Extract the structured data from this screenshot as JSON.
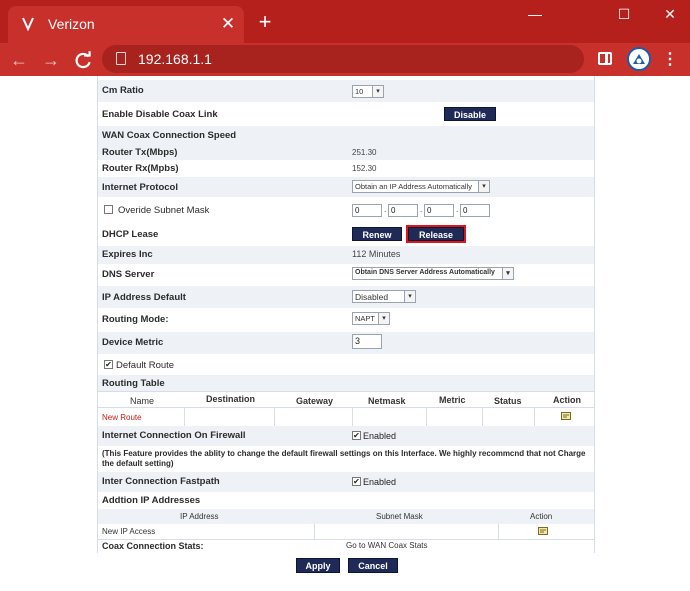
{
  "browser": {
    "tab_title": "Verizon",
    "new_tab": "+",
    "url": "192.168.1.1",
    "window_controls": {
      "minimize": "—",
      "maximize": "☐",
      "close": "✕"
    },
    "chrome_color": "#c8302b",
    "tabbar_color": "#b5201c"
  },
  "settings": {
    "cm_ratio": {
      "label": "Cm Ratio",
      "value": "10"
    },
    "coax_link": {
      "label": "Enable Disable Coax Link",
      "button": "Disable"
    },
    "wan_coax_speed": "WAN Coax Connection Speed",
    "router_tx": {
      "label": "Router Tx(Mbps)",
      "value": "251.30"
    },
    "router_rx": {
      "label": "Router Rx(Mpbs)",
      "value": "152.30"
    },
    "internet_protocol": {
      "label": "Internet Protocol",
      "value": "Obtain an IP Address Automatically"
    },
    "override_subnet": {
      "label": "Overide Subnet Mask",
      "octets": [
        "0",
        "0",
        "0",
        "0"
      ],
      "dot": "."
    },
    "dhcp_lease": {
      "label": "DHCP Lease",
      "renew": "Renew",
      "release": "Release"
    },
    "expires": {
      "label": "Expires Inc",
      "value": "112 Minutes"
    },
    "dns_server": {
      "label": "DNS Server",
      "value": "Obtain DNS Server Address Automatically"
    },
    "ip_default": {
      "label": "IP Address Default",
      "value": "Disabled"
    },
    "routing_mode": {
      "label": "Routing Mode:",
      "value": "NAPT"
    },
    "device_metric": {
      "label": "Device Metric",
      "value": "3"
    },
    "default_route": {
      "label": "Default Route",
      "check": "✔"
    },
    "routing_table": {
      "label": "Routing Table",
      "columns": [
        "Name",
        "Destination",
        "Gateway",
        "Netmask",
        "Metric",
        "Status",
        "Action"
      ],
      "new_route": "New Route"
    },
    "firewall": {
      "label": "Internet Connection On Firewall",
      "value": "Enabled"
    },
    "firewall_note": "(This Feature provides the ablity to change the default firewall settings on this Interface. We highly recommcnd that not Charge the default setting)",
    "fastpath": {
      "label": "Inter Connection Fastpath",
      "value": "Enabled"
    },
    "addition_ip": {
      "label": "Addtion IP Addresses",
      "columns": [
        "IP Address",
        "Subnet Mask",
        "Action"
      ],
      "new_ip": "New IP Access"
    },
    "coax_stats": {
      "label": "Coax Connection Stats:",
      "link": "Go to WAN Coax Stats"
    }
  },
  "actions": {
    "apply": "Apply",
    "cancel": "Cancel"
  },
  "colors": {
    "button": "#1f2a57",
    "highlight": "#e0141c",
    "shade": "#eef1f6"
  }
}
